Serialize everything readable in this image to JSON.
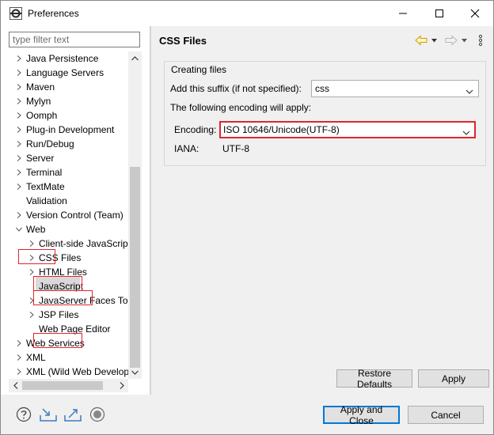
{
  "window": {
    "title": "Preferences"
  },
  "left": {
    "filter_placeholder": "type filter text",
    "tree": [
      {
        "label": "Java Persistence"
      },
      {
        "label": "Language Servers"
      },
      {
        "label": "Maven"
      },
      {
        "label": "Mylyn"
      },
      {
        "label": "Oomph"
      },
      {
        "label": "Plug-in Development"
      },
      {
        "label": "Run/Debug"
      },
      {
        "label": "Server"
      },
      {
        "label": "Terminal"
      },
      {
        "label": "TextMate"
      },
      {
        "label": "Validation"
      },
      {
        "label": "Version Control (Team)"
      },
      {
        "label": "Web"
      },
      {
        "label": "Client-side JavaScript"
      },
      {
        "label": "CSS Files"
      },
      {
        "label": "HTML Files"
      },
      {
        "label": "JavaScript"
      },
      {
        "label": "JavaServer Faces Tools"
      },
      {
        "label": "JSP Files"
      },
      {
        "label": "Web Page Editor"
      },
      {
        "label": "Web Services"
      },
      {
        "label": "XML"
      },
      {
        "label": "XML (Wild Web Developer)"
      }
    ]
  },
  "right": {
    "title": "CSS Files",
    "group_label": "Creating files",
    "suffix_label": "Add this suffix (if not specified):",
    "suffix_value": "css",
    "encoding_note": "The following encoding will apply:",
    "encoding_label": "Encoding:",
    "encoding_value": "ISO 10646/Unicode(UTF-8)",
    "iana_label": "IANA:",
    "iana_value": "UTF-8",
    "restore_defaults": "Restore Defaults",
    "apply": "Apply"
  },
  "bottom": {
    "apply_close": "Apply and Close",
    "cancel": "Cancel"
  },
  "colors": {
    "highlight": "#e0262e",
    "focus_border": "#0078d7"
  }
}
